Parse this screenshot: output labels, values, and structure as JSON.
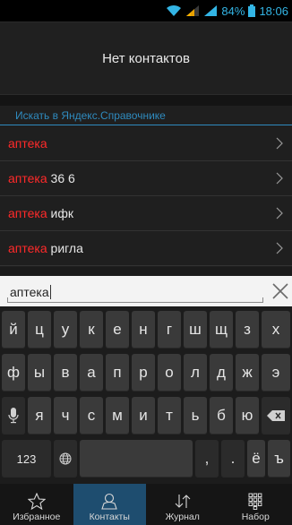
{
  "status_bar": {
    "battery": "84%",
    "time": "18:06",
    "accent": "#33b5e5"
  },
  "header": {
    "title": "Нет контактов"
  },
  "search_section": {
    "label": "Искать в Яндекс.Справочнике",
    "accent": "#2f8bbf"
  },
  "results": [
    {
      "highlight": "аптека",
      "rest": ""
    },
    {
      "highlight": "аптека",
      "rest": " 36 6"
    },
    {
      "highlight": "аптека",
      "rest": " ифк"
    },
    {
      "highlight": "аптека",
      "rest": " ригла"
    }
  ],
  "highlight_color": "#ff2a2a",
  "input": {
    "value": "аптека"
  },
  "keyboard": {
    "row1": [
      "й",
      "ц",
      "у",
      "к",
      "е",
      "н",
      "г",
      "ш",
      "щ",
      "з",
      "х"
    ],
    "row2": [
      "ф",
      "ы",
      "в",
      "а",
      "п",
      "р",
      "о",
      "л",
      "д",
      "ж",
      "э"
    ],
    "row3": [
      "я",
      "ч",
      "с",
      "м",
      "и",
      "т",
      "ь",
      "б",
      "ю"
    ],
    "row4": {
      "symbols": "123",
      "comma": ",",
      "period": ".",
      "yo": "ё",
      "hard": "ъ"
    }
  },
  "bottom_nav": [
    {
      "label": "Избранное",
      "icon": "star-icon"
    },
    {
      "label": "Контакты",
      "icon": "person-icon",
      "active": true
    },
    {
      "label": "Журнал",
      "icon": "call-log-icon"
    },
    {
      "label": "Набор",
      "icon": "dialpad-icon"
    }
  ]
}
